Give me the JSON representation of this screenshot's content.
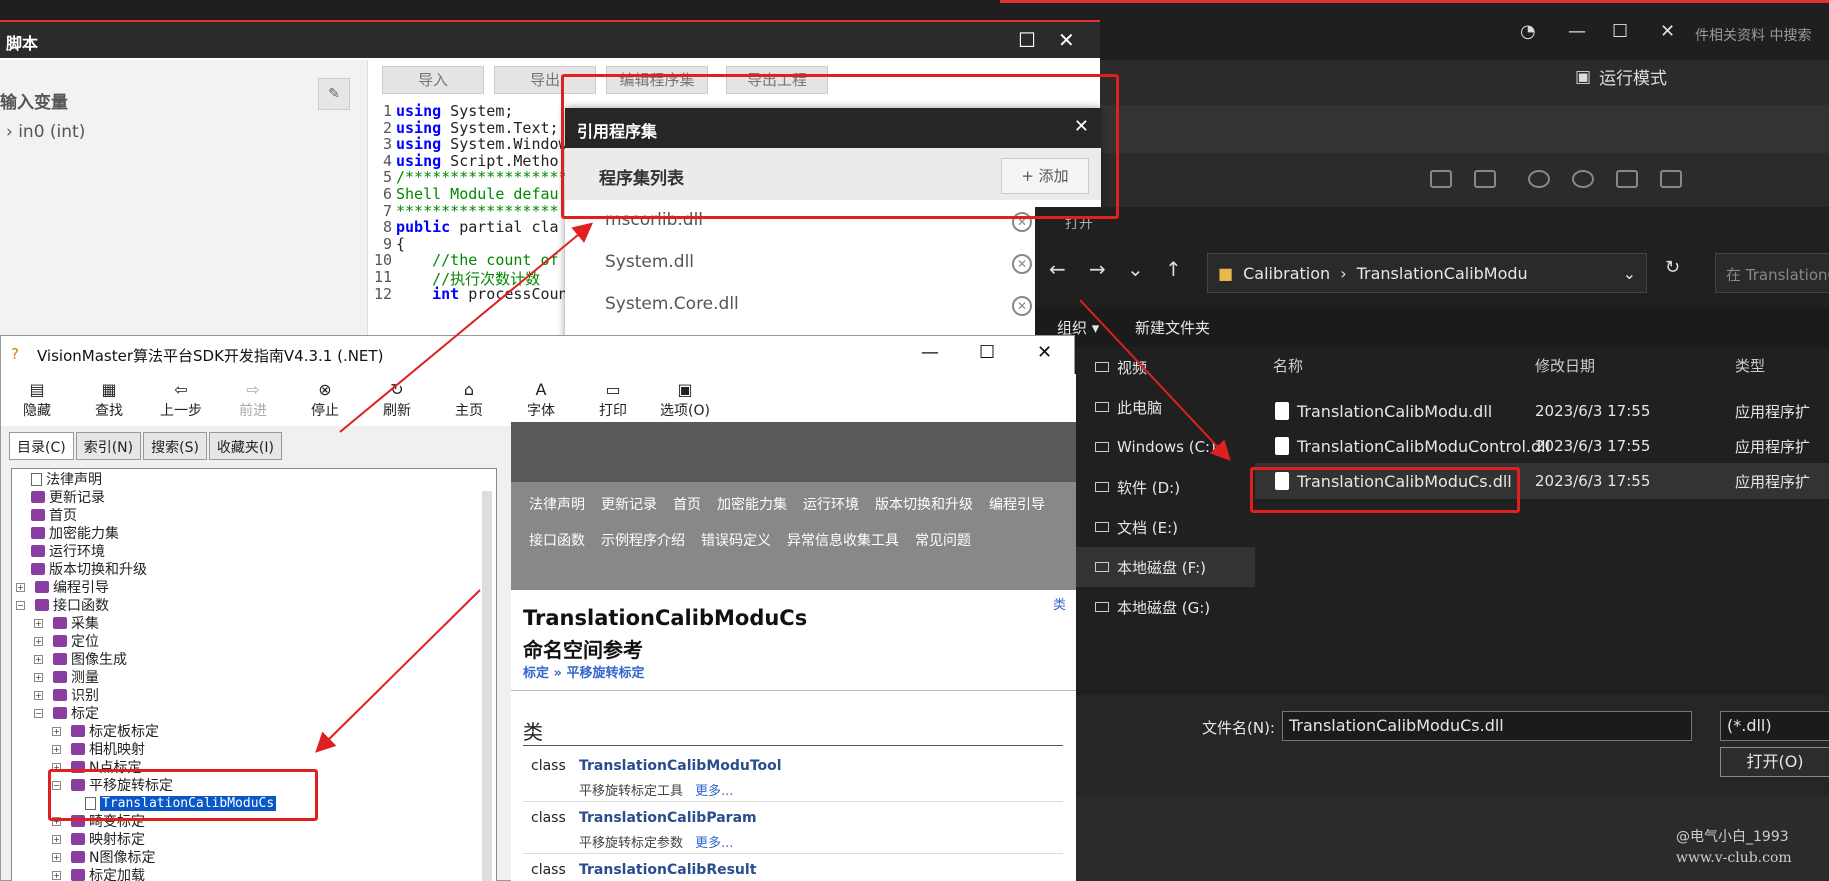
{
  "bg_app": {
    "search_hint": "件相关资料 中搜索",
    "run_mode": "运行模式"
  },
  "script_win": {
    "title": "脚本",
    "left_header": "输入变量",
    "var": "in0 (int)",
    "toolbar": [
      "导入",
      "导出",
      "编辑程序集",
      "导出工程"
    ]
  },
  "code_lines": [
    {
      "n": "1",
      "k": "using",
      "t": " System;"
    },
    {
      "n": "2",
      "k": "using",
      "t": " System.Text;"
    },
    {
      "n": "3",
      "k": "using",
      "t": " System.Window"
    },
    {
      "n": "4",
      "k": "using",
      "t": " Script.Metho"
    },
    {
      "n": "5",
      "c": "/******************"
    },
    {
      "n": "6",
      "c": "Shell Module defau"
    },
    {
      "n": "7",
      "c": "******************"
    },
    {
      "n": "8",
      "k": "public",
      "t": " partial cla"
    },
    {
      "n": "9",
      "t": "{"
    },
    {
      "n": "10",
      "c": "    //the count of"
    },
    {
      "n": "11",
      "c": "    //执行次数计数"
    },
    {
      "n": "12",
      "k": "    int",
      "t": " processCoun"
    }
  ],
  "asm_dialog": {
    "title": "引用程序集",
    "list_title": "程序集列表",
    "add": "添加",
    "items": [
      "mscorlib.dll",
      "System.dll",
      "System.Core.dll"
    ]
  },
  "open_dialog": {
    "title": "打开",
    "path": [
      "Calibration",
      "TranslationCalibModu"
    ],
    "search": "在 TranslationC",
    "organize": "组织 ▾",
    "new_folder": "新建文件夹",
    "sidebar": [
      "视频",
      "此电脑",
      "Windows (C:)",
      "软件 (D:)",
      "文档 (E:)",
      "本地磁盘 (F:)",
      "本地磁盘 (G:)"
    ],
    "col_name": "名称",
    "col_date": "修改日期",
    "col_type": "类型",
    "files": [
      {
        "name": "TranslationCalibModu.dll",
        "date": "2023/6/3 17:55",
        "type": "应用程序扩"
      },
      {
        "name": "TranslationCalibModuControl.dll",
        "date": "2023/6/3 17:55",
        "type": "应用程序扩"
      },
      {
        "name": "TranslationCalibModuCs.dll",
        "date": "2023/6/3 17:55",
        "type": "应用程序扩"
      }
    ],
    "filename_label": "文件名(N):",
    "filename": "TranslationCalibModuCs.dll",
    "filter": "(*.dll)",
    "open_btn": "打开(O)"
  },
  "help": {
    "title": "VisionMaster算法平台SDK开发指南V4.3.1 (.NET)",
    "toolbar": [
      "隐藏",
      "查找",
      "上一步",
      "前进",
      "停止",
      "刷新",
      "主页",
      "字体",
      "打印",
      "选项(O)"
    ],
    "tabs": [
      "目录(C)",
      "索引(N)",
      "搜索(S)",
      "收藏夹(I)"
    ],
    "tree": [
      "法律声明",
      "更新记录",
      "首页",
      "加密能力集",
      "运行环境",
      "版本切换和升级",
      "编程引导",
      "接口函数",
      "采集",
      "定位",
      "图像生成",
      "测量",
      "识别",
      "标定",
      "标定板标定",
      "相机映射",
      "N点标定",
      "平移旋转标定",
      "TranslationCalibModuCs",
      "畸变标定",
      "映射标定",
      "N图像标定",
      "标定加载"
    ],
    "nav": [
      "法律声明",
      "更新记录",
      "首页",
      "加密能力集",
      "运行环境",
      "版本切换和升级",
      "编程引导",
      "接口函数",
      "示例程序介绍",
      "错误码定义",
      "异常信息收集工具",
      "常见问题"
    ],
    "page_title": "TranslationCalibModuCs",
    "page_sub": "命名空间参考",
    "crumb": "标定 » 平移旋转标定",
    "more_link": "类",
    "section": "类",
    "classes": [
      {
        "kind": "class",
        "name": "TranslationCalibModuTool",
        "desc": "平移旋转标定工具",
        "more": "更多..."
      },
      {
        "kind": "class",
        "name": "TranslationCalibParam",
        "desc": "平移旋转标定参数",
        "more": "更多..."
      },
      {
        "kind": "class",
        "name": "TranslationCalibResult",
        "desc": "",
        "more": ""
      }
    ]
  },
  "watermark": {
    "user": "@电气小白_1993",
    "site": "www.v-club.com"
  }
}
